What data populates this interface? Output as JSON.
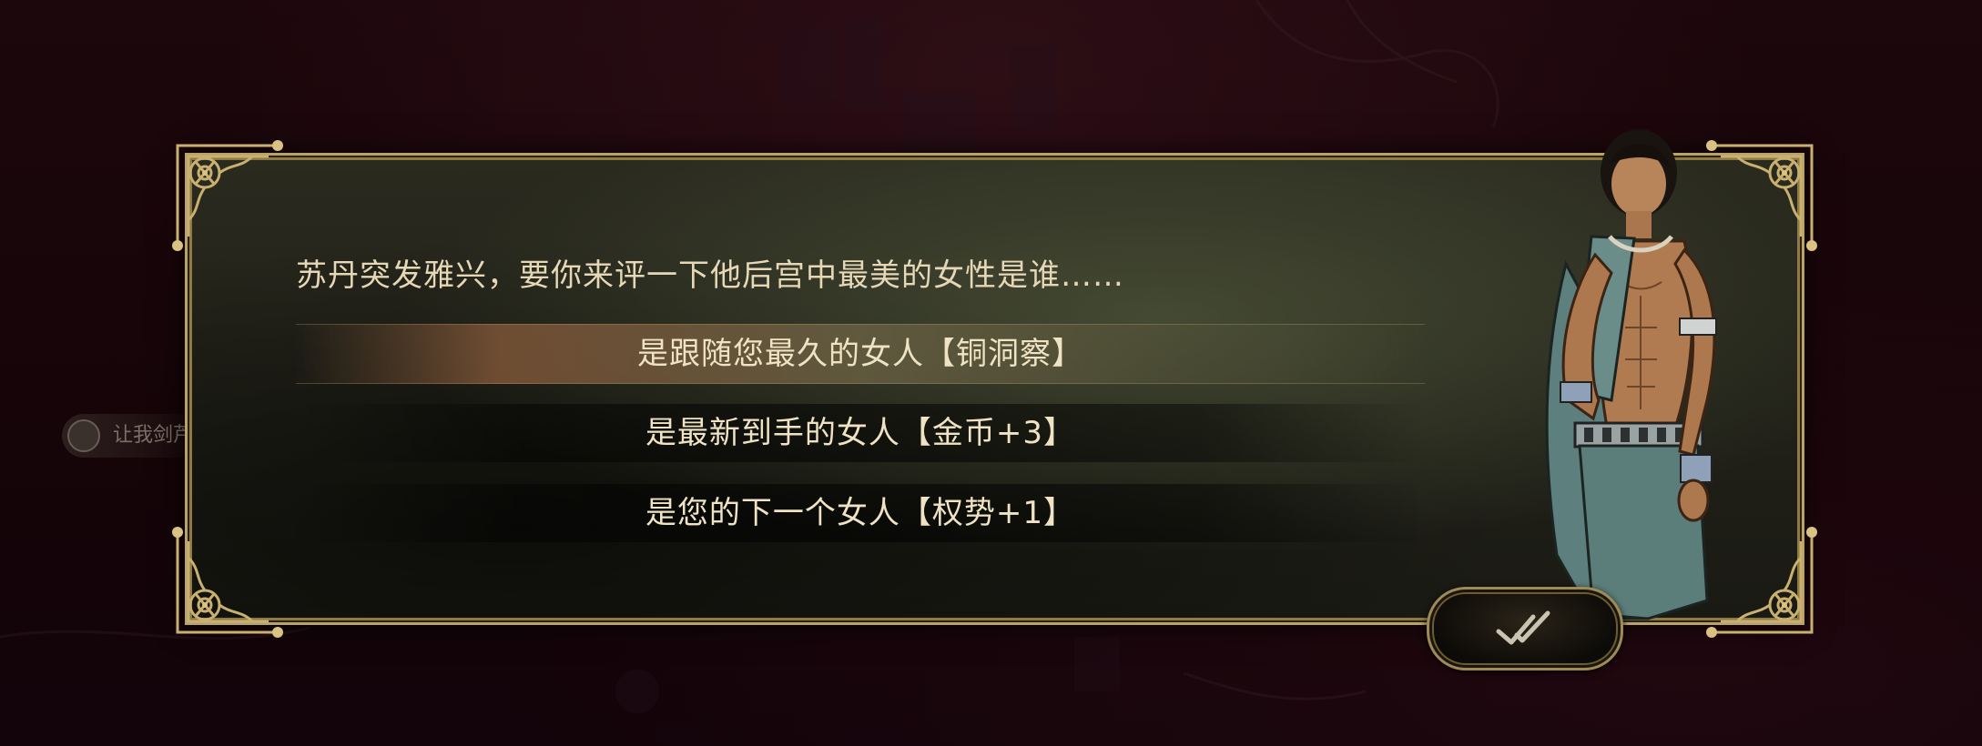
{
  "dialog": {
    "prompt": "苏丹突发雅兴，要你来评一下他后宫中最美的女性是谁……",
    "choices": [
      {
        "label": "是跟随您最久的女人【铜洞察】",
        "selected": true
      },
      {
        "label": "是最新到手的女人【金币+3】",
        "selected": false
      },
      {
        "label": "是您的下一个女人【权势+1】",
        "selected": false
      }
    ],
    "confirm_icon": "double-check-icon"
  },
  "background": {
    "side_tag": "让我剑芦"
  },
  "colors": {
    "gold_frame": "#b9a36a",
    "panel": "#23231a",
    "text": "#e6d8b6",
    "background": "#160508"
  }
}
